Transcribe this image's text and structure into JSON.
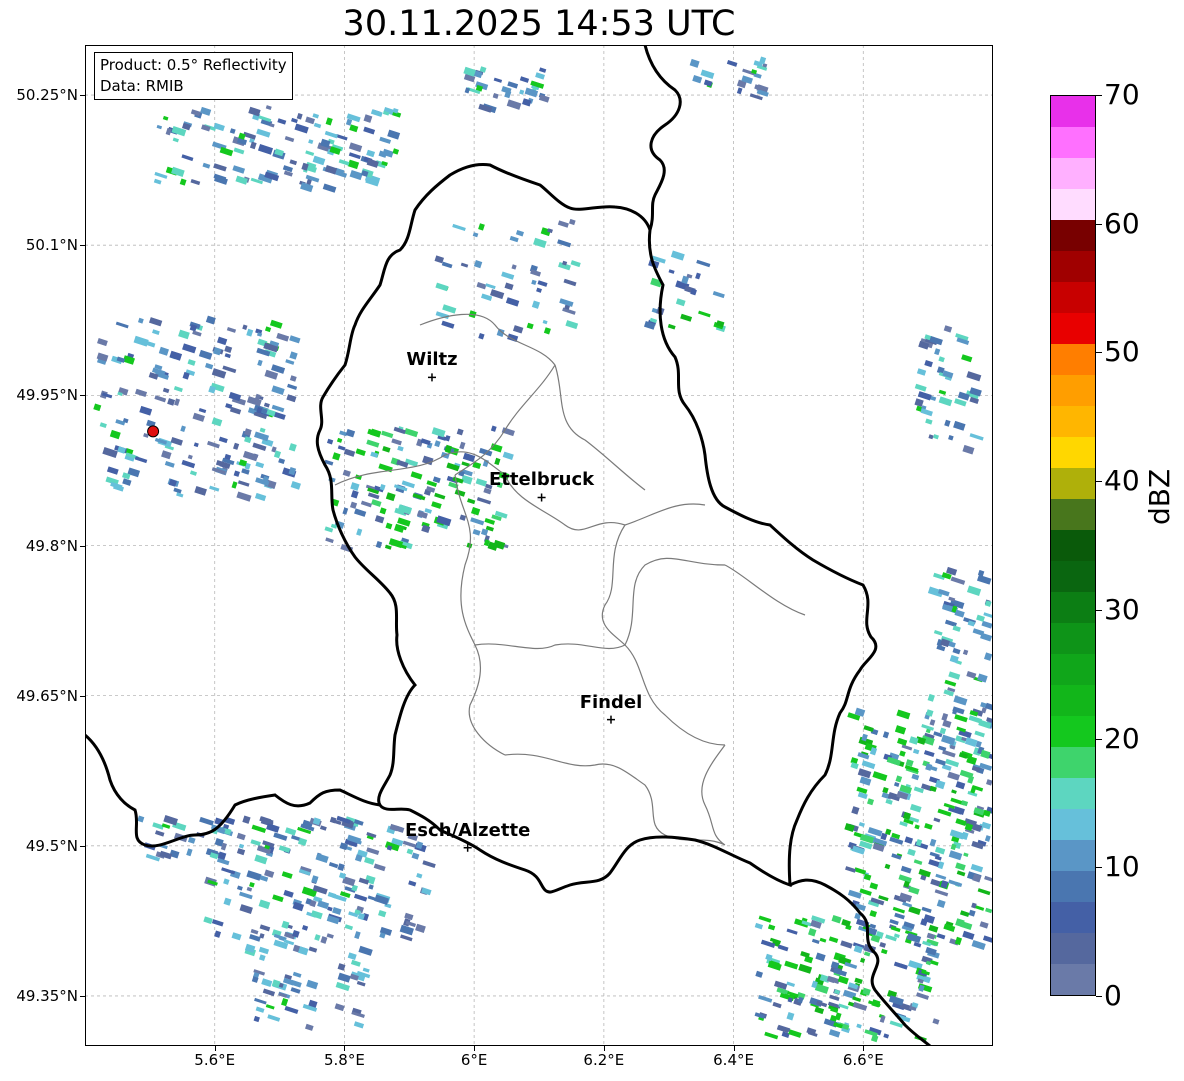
{
  "title": "30.11.2025 14:53 UTC",
  "info": {
    "product": "Product: 0.5° Reflectivity",
    "data_source": "Data: RMIB"
  },
  "map": {
    "lon_range": [
      5.4,
      6.8
    ],
    "lat_range": [
      49.3,
      50.3
    ],
    "lon_ticks": [
      "5.6°E",
      "5.8°E",
      "6°E",
      "6.2°E",
      "6.4°E",
      "6.6°E"
    ],
    "lat_ticks": [
      "49.35°N",
      "49.5°N",
      "49.65°N",
      "49.8°N",
      "49.95°N",
      "50.1°N",
      "50.25°N"
    ],
    "gridlines": true,
    "radar_site": {
      "lon": 5.505,
      "lat": 49.914,
      "marker_color": "#e01010"
    },
    "cities": [
      {
        "name": "Wiltz",
        "lon": 5.935,
        "lat": 49.968
      },
      {
        "name": "Ettelbruck",
        "lon": 6.104,
        "lat": 49.848
      },
      {
        "name": "Findel",
        "lon": 6.211,
        "lat": 49.626
      },
      {
        "name": "Esch/Alzette",
        "lon": 5.99,
        "lat": 49.498
      }
    ]
  },
  "colorbar": {
    "label": "dBZ",
    "min": 0,
    "max": 70,
    "tick_labels": [
      "0",
      "10",
      "20",
      "30",
      "40",
      "50",
      "60",
      "70"
    ],
    "colors": [
      "#6a7aa8",
      "#55689e",
      "#4460a6",
      "#4a76b0",
      "#5a96c6",
      "#66c0da",
      "#5dd6c0",
      "#3ed46c",
      "#14c81e",
      "#12b61a",
      "#10a61a",
      "#0e9418",
      "#0c7e14",
      "#0a6610",
      "#0a5a0a",
      "#48761c",
      "#afb00a",
      "#ffd700",
      "#ffb600",
      "#ff9e00",
      "#ff7e00",
      "#e80000",
      "#c80000",
      "#a00000",
      "#780000",
      "#ffdcff",
      "#ffb0ff",
      "#ff70ff",
      "#e830ea"
    ]
  }
}
